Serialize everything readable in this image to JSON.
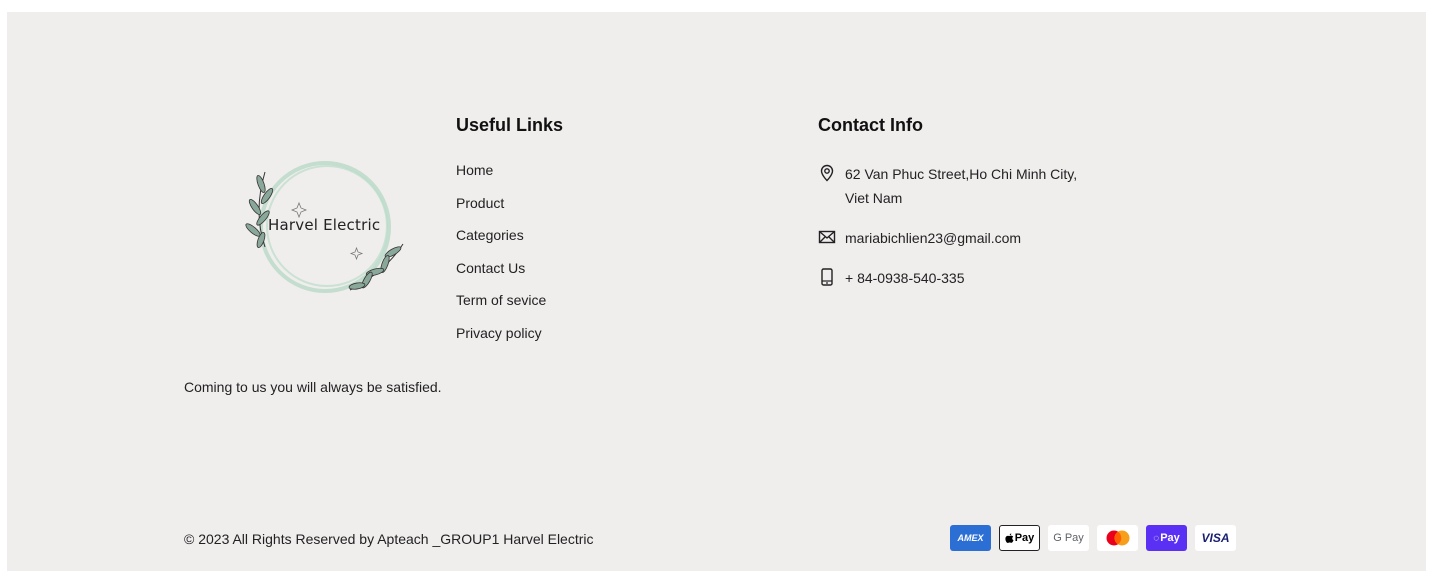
{
  "brand": {
    "logo_text": "Harvel Electric",
    "tagline": "Coming to us you will always be satisfied."
  },
  "links": {
    "title": "Useful Links",
    "items": [
      "Home",
      "Product",
      "Categories",
      "Contact Us",
      "Term of sevice",
      "Privacy policy"
    ]
  },
  "contact": {
    "title": "Contact Info",
    "address": "62 Van Phuc Street,Ho Chi Minh City, Viet Nam",
    "email": "mariabichlien23@gmail.com",
    "phone": "+ 84-0938-540-335",
    "icons": [
      "location-pin-icon",
      "envelope-icon",
      "mobile-phone-icon"
    ]
  },
  "footer": {
    "copyright": "© 2023 All Rights Reserved by Apteach _GROUP1 Harvel Electric"
  },
  "payments": [
    {
      "name": "amex-icon",
      "label": "AMEX",
      "bg": "#2b6fd4",
      "fg": "#ffffff"
    },
    {
      "name": "apple-pay-icon",
      "label": "Pay",
      "bg": "#ffffff",
      "fg": "#000000"
    },
    {
      "name": "google-pay-icon",
      "label": "G Pay",
      "bg": "#ffffff",
      "fg": "#5f6368"
    },
    {
      "name": "mastercard-icon",
      "label": "",
      "bg": "#ffffff",
      "fg": "#000000"
    },
    {
      "name": "shop-pay-icon",
      "label": "Pay",
      "bg": "#5a31f4",
      "fg": "#ffffff"
    },
    {
      "name": "visa-icon",
      "label": "VISA",
      "bg": "#ffffff",
      "fg": "#1a1f71"
    }
  ],
  "colors": {
    "footer_bg": "#f0eded",
    "leaf_green": "#9fcfb6"
  }
}
